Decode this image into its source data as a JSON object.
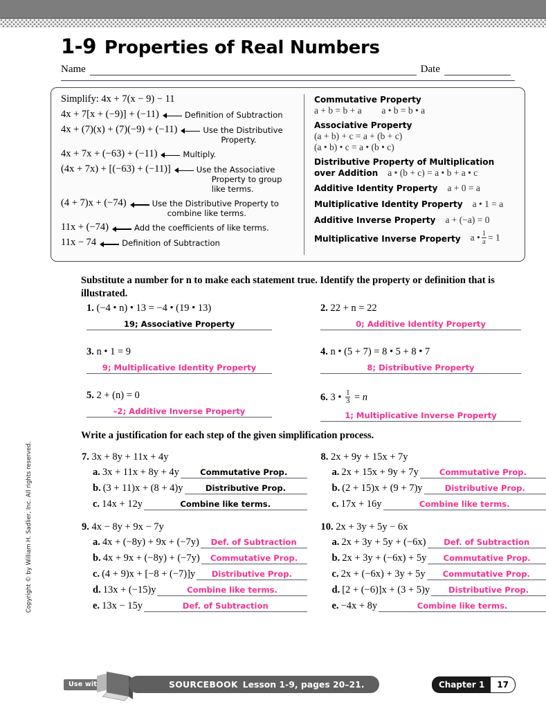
{
  "header": {
    "lesson_number": "1-9",
    "lesson_title": "Properties of Real Numbers",
    "name_label": "Name",
    "date_label": "Date"
  },
  "example_box": {
    "steps": [
      {
        "expr": "Simplify: 4x + 7(x − 9) − 11",
        "reason": ""
      },
      {
        "expr": "4x + 7[x + (−9)] + (−11)",
        "reason": "Definition of Subtraction"
      },
      {
        "expr": "4x + (7)(x) + (7)(−9) + (−11)",
        "reason": "Use the Distributive",
        "reason2": "Property."
      },
      {
        "expr": "4x + 7x + (−63) + (−11)",
        "reason": "Multiply."
      },
      {
        "expr": "(4x + 7x) + [(−63) + (−11)]",
        "reason": "Use the Associative",
        "reason2": "Property to group",
        "reason3": "like terms."
      },
      {
        "expr": "(4 + 7)x + (−74)",
        "reason": "Use the Distributive Property to",
        "reason2": "combine like terms."
      },
      {
        "expr": "11x + (−74)",
        "reason": "Add the coefficients of like terms."
      },
      {
        "expr": "11x − 74",
        "reason": "Definition of Subtraction"
      }
    ],
    "properties": [
      {
        "name": "Commutative Property",
        "eq": "a + b = b + a",
        "eq2": "a • b = b • a",
        "layout": "stacked"
      },
      {
        "name": "Associative Property",
        "eq": "(a + b) + c = a + (b + c)",
        "eq2": "(a • b) • c = a • (b • c)",
        "layout": "stacked-two-lines"
      },
      {
        "name": "Distributive Property of Multiplication",
        "name2": "over Addition",
        "eq": "a • (b + c) = a • b + a • c",
        "layout": "two-line-name"
      },
      {
        "name": "Additive Identity Property",
        "eq": "a + 0 = a",
        "layout": "inline"
      },
      {
        "name": "Multiplicative Identity Property",
        "eq": "a • 1 = a",
        "layout": "inline"
      },
      {
        "name": "Additive Inverse Property",
        "eq": "a + (−a) = 0",
        "layout": "inline"
      },
      {
        "name": "Multiplicative Inverse Property",
        "eq_prefix": "a •",
        "eq_num": "1",
        "eq_den": "a",
        "eq_suffix": "= 1",
        "layout": "inline-fraction"
      }
    ]
  },
  "section1": {
    "instruction": "Substitute a number for n to make each statement true. Identify the property or definition that is illustrated.",
    "items": [
      {
        "number": "1.",
        "question": "(−4 • n) • 13 = −4 • (19 • 13)",
        "answer": "19; Associative Property",
        "ink": false
      },
      {
        "number": "2.",
        "question": "22 + n = 22",
        "answer": "0; Additive Identity Property",
        "ink": true
      },
      {
        "number": "3.",
        "question": "n • 1 = 9",
        "answer": "9; Multiplicative Identity Property",
        "ink": true
      },
      {
        "number": "4.",
        "question": "n • (5 + 7) = 8 • 5 + 8 • 7",
        "answer": "8; Distributive Property",
        "ink": true
      },
      {
        "number": "5.",
        "question": "2 + (n) = 0",
        "answer": "–2; Additive Inverse Property",
        "ink": true
      },
      {
        "number": "6.",
        "question": "3 • 1/3 = n",
        "answer": "1; Multiplicative Inverse Property",
        "ink": true
      }
    ]
  },
  "section2": {
    "instruction": "Write a justification for each step of the given simplification process.",
    "problems": [
      {
        "number": "7.",
        "expression": "3x + 8y + 11x + 4y",
        "steps": [
          {
            "label": "a.",
            "expr": "3x + 11x + 8y + 4y",
            "answer": "Commutative Prop.",
            "ink": false
          },
          {
            "label": "b.",
            "expr": "(3 + 11)x + (8 + 4)y",
            "answer": "Distributive Prop.",
            "ink": false
          },
          {
            "label": "c.",
            "expr": "14x + 12y",
            "answer": "Combine like terms.",
            "ink": false
          }
        ]
      },
      {
        "number": "8.",
        "expression": "2x + 9y + 15x + 7y",
        "steps": [
          {
            "label": "a.",
            "expr": "2x + 15x + 9y + 7y",
            "answer": "Commutative Prop.",
            "ink": true
          },
          {
            "label": "b.",
            "expr": "(2 + 15)x + (9 + 7)y",
            "answer": "Distributive Prop.",
            "ink": true
          },
          {
            "label": "c.",
            "expr": "17x + 16y",
            "answer": "Combine like terms.",
            "ink": true
          }
        ]
      },
      {
        "number": "9.",
        "expression": "4x − 8y + 9x − 7y",
        "steps": [
          {
            "label": "a.",
            "expr": "4x + (−8y) + 9x + (−7y)",
            "answer": "Def. of Subtraction",
            "ink": true
          },
          {
            "label": "b.",
            "expr": "4x + 9x + (−8y) + (−7y)",
            "answer": "Commutative Prop.",
            "ink": true
          },
          {
            "label": "c.",
            "expr": "(4 + 9)x + [−8 + (−7)]y",
            "answer": "Distributive Prop.",
            "ink": true
          },
          {
            "label": "d.",
            "expr": "13x + (−15)y",
            "answer": "Combine like terms.",
            "ink": true
          },
          {
            "label": "e.",
            "expr": "13x − 15y",
            "answer": "Def. of Subtraction",
            "ink": true
          }
        ]
      },
      {
        "number": "10.",
        "expression": "2x + 3y + 5y − 6x",
        "steps": [
          {
            "label": "a.",
            "expr": "2x + 3y + 5y + (−6x)",
            "answer": "Def. of Subtraction",
            "ink": true
          },
          {
            "label": "b.",
            "expr": "2x + 3y + (−6x) + 5y",
            "answer": "Commutative Prop.",
            "ink": true
          },
          {
            "label": "c.",
            "expr": "2x + (−6x) + 3y + 5y",
            "answer": "Commutative Prop.",
            "ink": true
          },
          {
            "label": "d.",
            "expr": "[2 + (−6)]x + (3 + 5)y",
            "answer": "Distributive Prop.",
            "ink": true
          },
          {
            "label": "e.",
            "expr": "−4x + 8y",
            "answer": "Combine like terms.",
            "ink": true
          }
        ]
      }
    ]
  },
  "copyright": "Copyright © by William H. Sadlier, Inc. All rights reserved.",
  "footer": {
    "use_with": "Use with",
    "sourcebook_label": "SOURCEBOOK",
    "sourcebook_ref": "Lesson 1-9, pages 20–21.",
    "chapter_label": "Chapter 1",
    "page_number": "17"
  },
  "colors": {
    "ink_pink": "#f0338f",
    "topbar_gray": "#7d7d7d",
    "rule_gray": "#5b5b6b"
  }
}
